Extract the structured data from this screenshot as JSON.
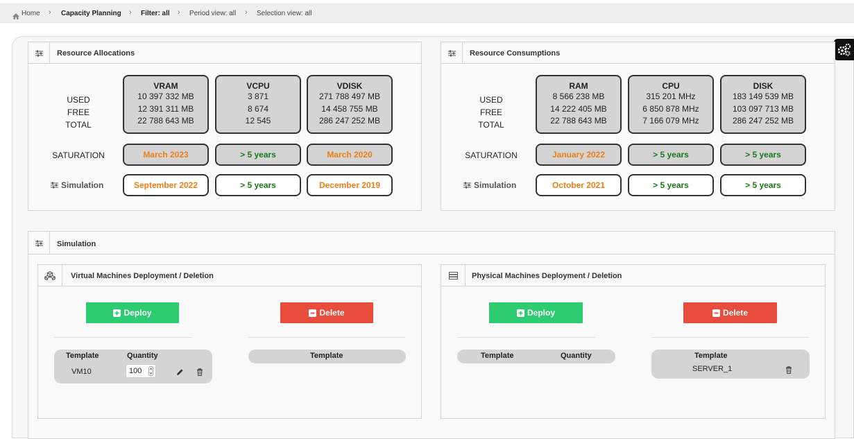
{
  "breadcrumb": {
    "home": "Home",
    "items": [
      "Capacity Planning",
      "Filter: all",
      "Period view: all",
      "Selection view: all"
    ]
  },
  "alloc": {
    "title": "Resource Allocations",
    "row_labels": [
      "USED",
      "FREE",
      "TOTAL"
    ],
    "saturation_label": "SATURATION",
    "simulation_label": "Simulation",
    "boxes": [
      {
        "name": "VRAM",
        "used": "10 397 332 MB",
        "free": "12 391 311 MB",
        "total": "22 788 643 MB",
        "saturation": "March 2023",
        "simulation": "September 2022"
      },
      {
        "name": "VCPU",
        "used": "3 871",
        "free": "8 674",
        "total": "12 545",
        "saturation": "> 5 years",
        "simulation": "> 5 years"
      },
      {
        "name": "VDISK",
        "used": "271 788 497 MB",
        "free": "14 458 755 MB",
        "total": "286 247 252 MB",
        "saturation": "March 2020",
        "simulation": "December 2019"
      }
    ]
  },
  "consume": {
    "title": "Resource Consumptions",
    "row_labels": [
      "USED",
      "FREE",
      "TOTAL"
    ],
    "saturation_label": "SATURATION",
    "simulation_label": "Simulation",
    "boxes": [
      {
        "name": "RAM",
        "used": "8 566 238 MB",
        "free": "14 222 405 MB",
        "total": "22 788 643 MB",
        "saturation": "January 2022",
        "simulation": "October 2021"
      },
      {
        "name": "CPU",
        "used": "315 201 MHz",
        "free": "6 850 878 MHz",
        "total": "7 166 079 MHz",
        "saturation": "> 5 years",
        "simulation": "> 5 years"
      },
      {
        "name": "DISK",
        "used": "183 149 539 MB",
        "free": "103 097 713 MB",
        "total": "286 247 252 MB",
        "saturation": "> 5 years",
        "simulation": "> 5 years"
      }
    ]
  },
  "simulation": {
    "title": "Simulation",
    "vm": {
      "title": "Virtual Machines Deployment / Deletion",
      "deploy_label": "Deploy",
      "delete_label": "Delete",
      "deploy_table": {
        "headers": [
          "Template",
          "Quantity"
        ],
        "rows": [
          {
            "template": "VM10",
            "quantity": "100"
          }
        ]
      },
      "delete_table": {
        "headers": [
          "Template"
        ]
      }
    },
    "pm": {
      "title": "Physical Machines Deployment / Deletion",
      "deploy_label": "Deploy",
      "delete_label": "Delete",
      "deploy_table": {
        "headers": [
          "Template",
          "Quantity"
        ]
      },
      "delete_table": {
        "headers": [
          "Template"
        ],
        "rows": [
          {
            "template": "SERVER_1"
          }
        ]
      }
    }
  },
  "colors": {
    "orange": "#f07d14",
    "green": "#1a7a1a",
    "deploy": "#2ecc71",
    "delete": "#e74c3c"
  }
}
